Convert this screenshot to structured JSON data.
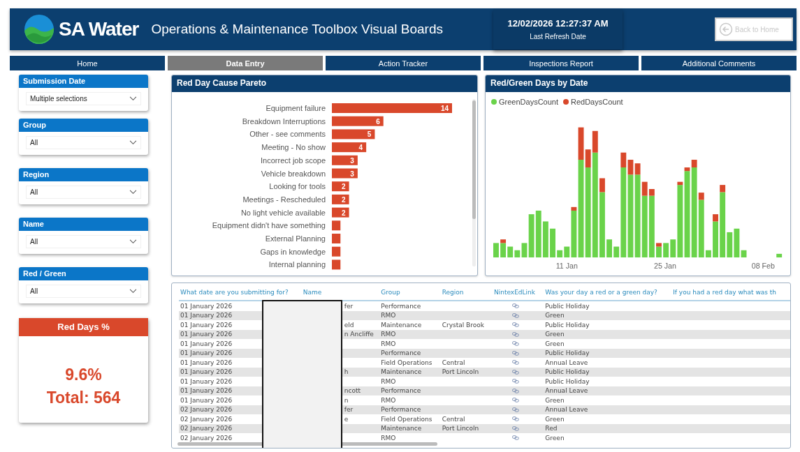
{
  "header": {
    "brand": "SA Water",
    "title": "Operations & Maintenance Toolbox Visual Boards",
    "refresh_time": "12/02/2026 12:27:37 AM",
    "refresh_label": "Last Refresh Date",
    "back_button": {
      "label": "Back to Home",
      "disabled": true
    }
  },
  "tabs": [
    {
      "label": "Home",
      "selected": false
    },
    {
      "label": "Data Entry",
      "selected": true
    },
    {
      "label": "Action Tracker",
      "selected": false
    },
    {
      "label": "Inspections Report",
      "selected": false
    },
    {
      "label": "Additional Comments",
      "selected": false
    }
  ],
  "filters": [
    {
      "title": "Submission Date",
      "value": "Multiple selections"
    },
    {
      "title": "Group",
      "value": "All"
    },
    {
      "title": "Region",
      "value": "All"
    },
    {
      "title": "Name",
      "value": "All"
    },
    {
      "title": "Red / Green",
      "value": "All"
    }
  ],
  "kpi": {
    "title": "Red Days %",
    "value": "9.6%",
    "total": "Total: 564"
  },
  "pareto": {
    "title": "Red Day Cause Pareto",
    "chart_data": {
      "type": "bar",
      "orientation": "horizontal",
      "categories": [
        "Equipment failure",
        "Breakdown Interruptions",
        "Other - see comments",
        "Meeting - No show",
        "Incorrect job scope",
        "Vehicle breakdown",
        "Looking for tools",
        "Meetings - Rescheduled",
        "No light vehicle available",
        "Equipment didn't have something",
        "External Planning",
        "Gaps in knowledge",
        "Internal planning"
      ],
      "values": [
        14,
        6,
        5,
        4,
        3,
        3,
        2,
        2,
        2,
        1,
        1,
        1,
        1
      ],
      "value_labels": [
        "14",
        "6",
        "5",
        "4",
        "3",
        "3",
        "2",
        "2",
        "2",
        null,
        null,
        null,
        null
      ]
    }
  },
  "date_chart": {
    "title": "Red/Green Days by Date",
    "legend": [
      {
        "label": "GreenDaysCount",
        "color": "#6ad34a"
      },
      {
        "label": "RedDaysCount",
        "color": "#d9482b"
      }
    ],
    "x_labels": [
      "11 Jan",
      "25 Jan",
      "08 Feb"
    ]
  },
  "table": {
    "columns": [
      "What date are you submitting for?",
      "Name",
      "Group",
      "Region",
      "NintexEdLink",
      "Was your day a red or a green day?",
      "If you had a red day what was th"
    ],
    "rows": [
      {
        "date": "01 January 2026",
        "name": "fer",
        "group": "Performance",
        "day": "Public Holiday"
      },
      {
        "date": "01 January 2026",
        "group": "RMO",
        "day": "Green"
      },
      {
        "date": "01 January 2026",
        "name": "eld",
        "group": "Maintenance",
        "region": "Crystal Brook",
        "day": "Public Holiday"
      },
      {
        "date": "01 January 2026",
        "name": "n Ancliffe",
        "group": "RMO",
        "day": "Green"
      },
      {
        "date": "01 January 2026",
        "group": "RMO",
        "day": "Green"
      },
      {
        "date": "01 January 2026",
        "group": "Performance",
        "day": "Public Holiday"
      },
      {
        "date": "01 January 2026",
        "group": "Field Operations",
        "region": "Central",
        "day": "Annual Leave"
      },
      {
        "date": "01 January 2026",
        "name": "h",
        "group": "Maintenance",
        "region": "Port Lincoln",
        "day": "Public Holiday"
      },
      {
        "date": "01 January 2026",
        "group": "RMO",
        "day": "Public Holiday"
      },
      {
        "date": "01 January 2026",
        "name": "ncott",
        "group": "Performance",
        "day": "Annual Leave"
      },
      {
        "date": "01 January 2026",
        "name": "n",
        "group": "RMO",
        "day": "Green"
      },
      {
        "date": "02 January 2026",
        "name": "fer",
        "group": "Performance",
        "day": "Annual Leave"
      },
      {
        "date": "02 January 2026",
        "name": "e",
        "group": "Field Operations",
        "region": "Central",
        "day": "Green"
      },
      {
        "date": "02 January 2026",
        "group": "Maintenance",
        "region": "Port Lincoln",
        "day": "Red"
      },
      {
        "date": "02 January 2026",
        "group": "RMO",
        "day": "Green"
      }
    ]
  }
}
